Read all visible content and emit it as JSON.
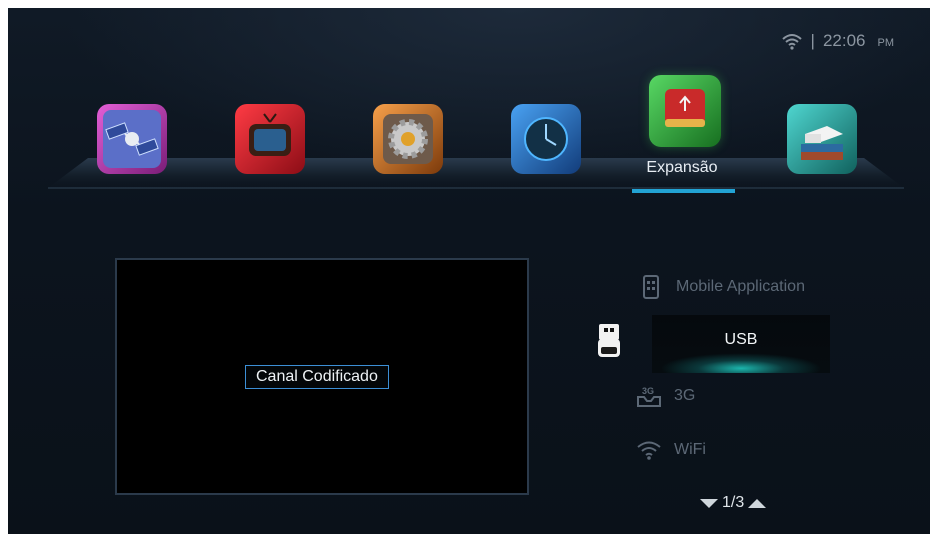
{
  "status": {
    "clock": "22:06",
    "ampm": "PM",
    "separator": "|",
    "wifi_icon": "wifi-icon"
  },
  "menu": {
    "items": [
      {
        "id": "satellite",
        "icon": "satellite-icon",
        "color": "#c53fbe"
      },
      {
        "id": "tv",
        "icon": "tv-icon",
        "color": "#c51f2b"
      },
      {
        "id": "settings",
        "icon": "gear-icon",
        "color": "#c86b1a"
      },
      {
        "id": "time",
        "icon": "clock-icon",
        "color": "#1f6fc4"
      },
      {
        "id": "expansion",
        "icon": "usb-drive-icon",
        "color": "#2fa53a",
        "label": "Expansão",
        "selected": true
      },
      {
        "id": "media",
        "icon": "books-icon",
        "color": "#1fa3a0"
      }
    ]
  },
  "preview": {
    "badge": "Canal Codificado"
  },
  "list": {
    "items": [
      {
        "label": "Mobile Application",
        "icon": "mobile-icon"
      },
      {
        "label": "USB",
        "icon": "usb-icon",
        "selected": true
      },
      {
        "label": "3G",
        "icon": "3g-icon"
      },
      {
        "label": "WiFi",
        "icon": "wifi-icon"
      }
    ],
    "page": "1/3"
  }
}
